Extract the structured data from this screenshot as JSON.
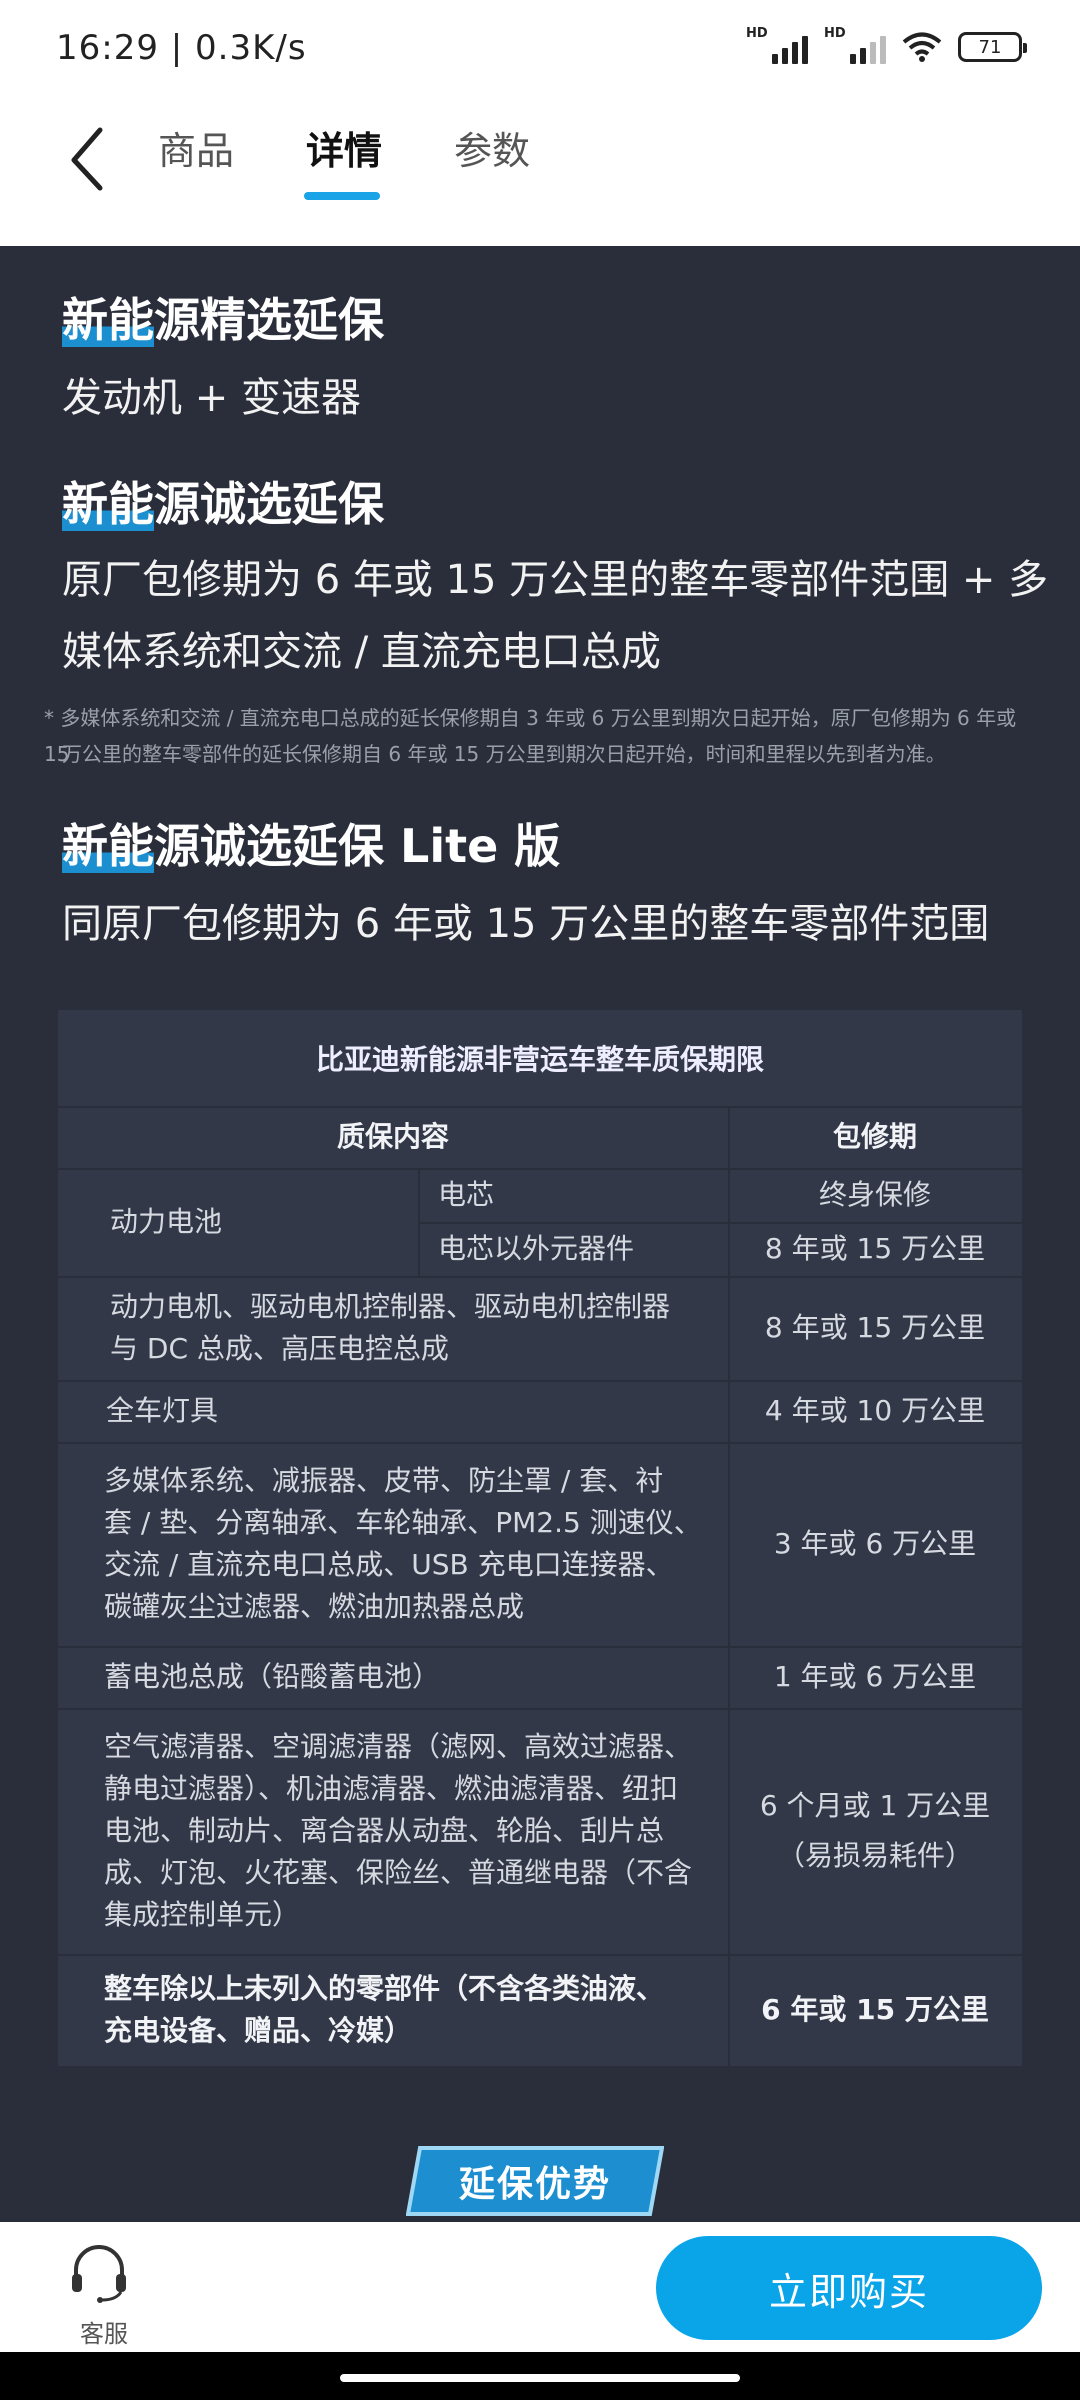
{
  "status_bar": {
    "time": "16:29 | 0.3K/s",
    "signal_label": "HD",
    "battery": "71"
  },
  "tabs": [
    {
      "label": "商品"
    },
    {
      "label": "详情"
    },
    {
      "label": "参数"
    }
  ],
  "sections": [
    {
      "title_hl": "新能",
      "title_rest": "源精选延保",
      "body": "发动机 + 变速器"
    },
    {
      "title_hl": "新能",
      "title_rest": "源诚选延保",
      "body_line1": "原厂包修期为 6 年或 15 万公里的整车零部件范围 + 多",
      "body_line2": "媒体系统和交流 / 直流充电口总成"
    },
    {
      "title_hl": "新能",
      "title_rest": "源诚选延保 Lite 版",
      "body": "同原厂包修期为 6 年或 15 万公里的整车零部件范围"
    }
  ],
  "note_line1": "* 多媒体系统和交流 / 直流充电口总成的延长保修期自 3 年或 6 万公里到期次日起开始，原厂包修期为 6 年或 15",
  "note_line2": "万公里的整车零部件的延长保修期自 6 年或 15 万公里到期次日起开始，时间和里程以先到者为准。",
  "table": {
    "title": "比亚迪新能源非营运车整车质保期限",
    "header_content": "质保内容",
    "header_period": "包修期",
    "battery_group": "动力电池",
    "rows": [
      {
        "content": "电芯",
        "period": "终身保修"
      },
      {
        "content": "电芯以外元器件",
        "period": "8 年或 15 万公里"
      },
      {
        "content_line1": "动力电机、驱动电机控制器、驱动电机控制器",
        "content_line2": "与 DC 总成、高压电控总成",
        "period": "8 年或 15 万公里"
      },
      {
        "content": "全车灯具",
        "period": "4 年或 10 万公里"
      },
      {
        "content_line1": "多媒体系统、减振器、皮带、防尘罩 / 套、衬",
        "content_line2": "套 / 垫、分离轴承、车轮轴承、PM2.5 测速仪、",
        "content_line3": "交流 / 直流充电口总成、USB 充电口连接器、",
        "content_line4": "碳罐灰尘过滤器、燃油加热器总成",
        "period": "3 年或 6 万公里"
      },
      {
        "content": "蓄电池总成（铅酸蓄电池）",
        "period": "1 年或 6 万公里"
      },
      {
        "content_line1": "空气滤清器、空调滤清器（滤网、高效过滤器、",
        "content_line2": "静电过滤器）、机油滤清器、燃油滤清器、纽扣",
        "content_line3": "电池、制动片、离合器从动盘、轮胎、刮片总",
        "content_line4": "成、灯泡、火花塞、保险丝、普通继电器（不含",
        "content_line5": "集成控制单元）",
        "period_line1": "6 个月或 1 万公里",
        "period_line2": "（易损易耗件）"
      },
      {
        "content_line1": "整车除以上未列入的零部件（不含各类油液、",
        "content_line2": "充电设备、赠品、冷媒）",
        "period": "6 年或 15 万公里"
      }
    ]
  },
  "badge": "延保优势",
  "bottom": {
    "service_label": "客服",
    "buy_label": "立即购买"
  },
  "colors": {
    "accent": "#0aa4e8",
    "content_bg": "#2a2e3a",
    "table_bg": "#323848"
  }
}
